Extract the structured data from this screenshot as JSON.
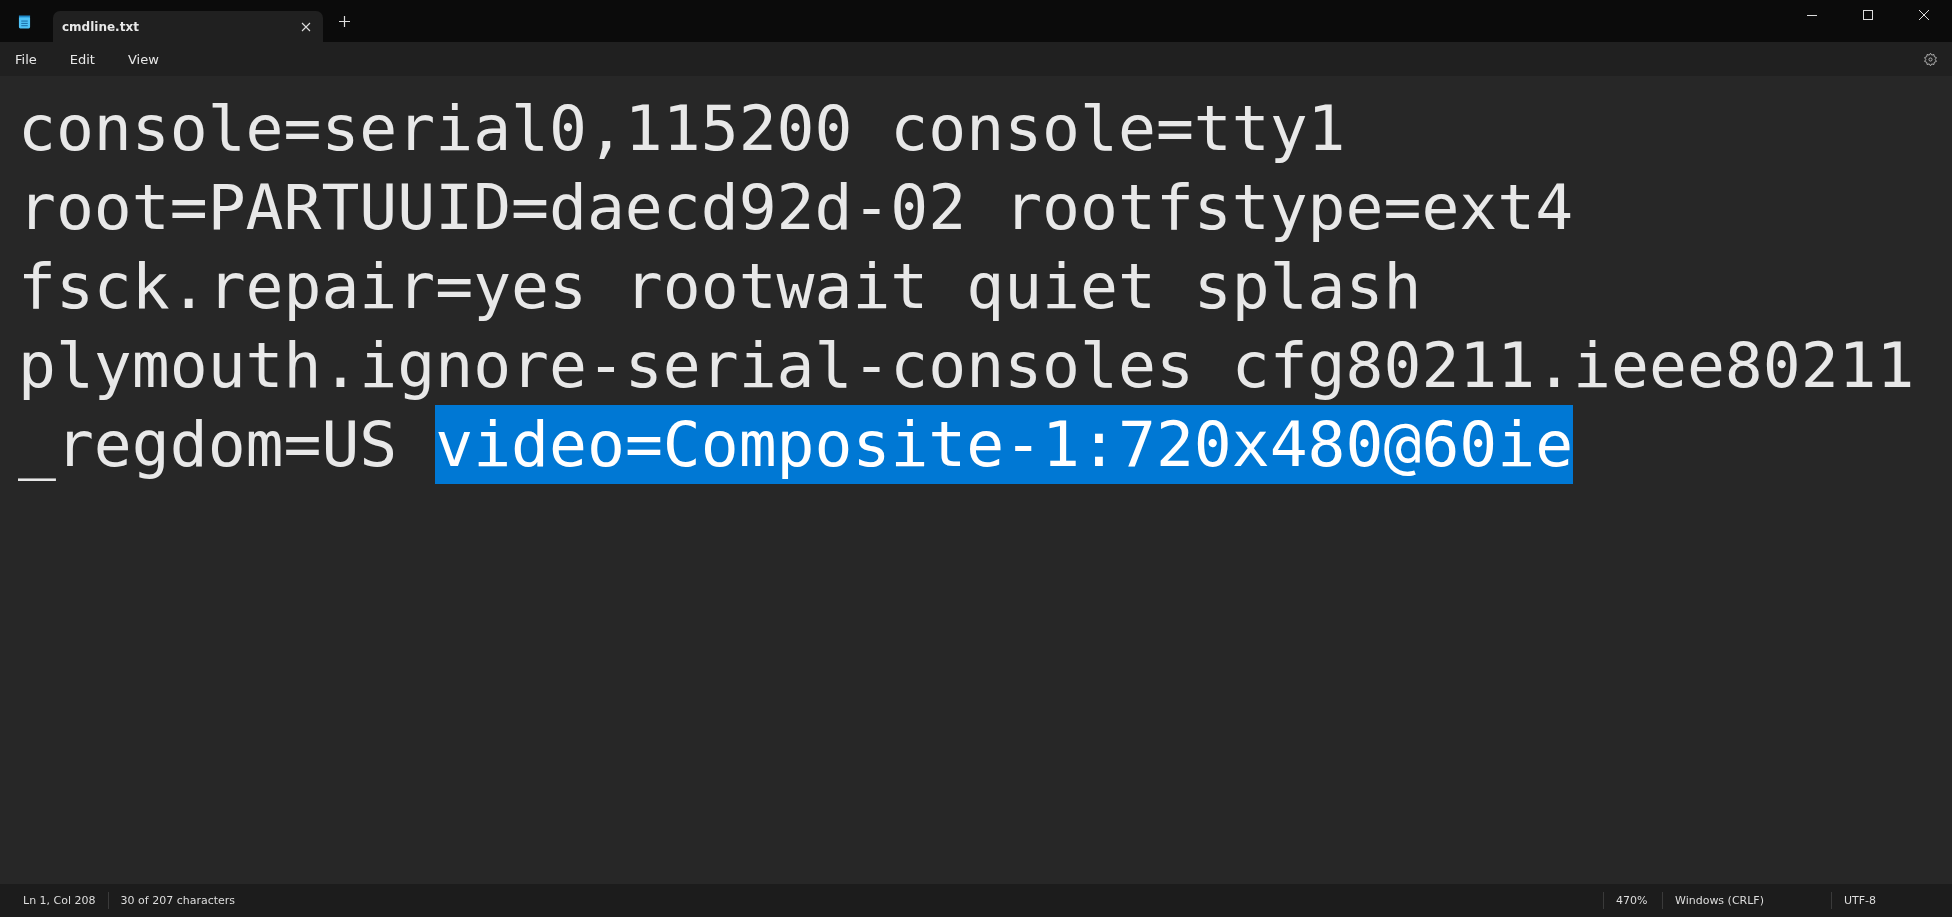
{
  "window": {
    "tabs": [
      {
        "label": "cmdline.txt",
        "selected": true
      }
    ]
  },
  "menu": [
    "File",
    "Edit",
    "View"
  ],
  "editor": {
    "lines": [
      {
        "segments": [
          {
            "text": "console=serial0,115200 console=tty1",
            "selected": false
          }
        ]
      },
      {
        "segments": [
          {
            "text": "root=PARTUUID=daecd92d-02 rootfstype=ext4",
            "selected": false
          }
        ]
      },
      {
        "segments": [
          {
            "text": "fsck.repair=yes rootwait quiet splash",
            "selected": false
          }
        ]
      },
      {
        "segments": [
          {
            "text": "plymouth.ignore-serial-consoles cfg80211.ieee80211",
            "selected": false
          }
        ]
      },
      {
        "segments": [
          {
            "text": "_regdom=US ",
            "selected": false
          },
          {
            "text": "video=Composite-1:720x480@60ie",
            "selected": true
          }
        ]
      }
    ]
  },
  "status_bar": {
    "position": "Ln 1, Col 208",
    "selection": "30 of 207 characters",
    "zoom": "470%",
    "line_ending": "Windows (CRLF)",
    "encoding": "UTF-8"
  }
}
